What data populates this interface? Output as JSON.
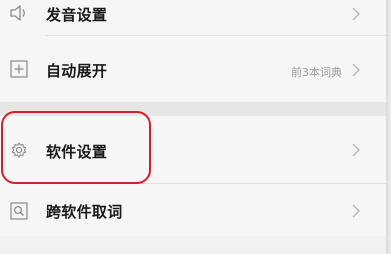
{
  "settings": {
    "items": [
      {
        "label": "发音设置",
        "value": "",
        "icon": "speaker-icon"
      },
      {
        "label": "自动展开",
        "value": "前3本词典",
        "icon": "plus-square-icon"
      },
      {
        "label": "软件设置",
        "value": "",
        "icon": "gear-icon"
      },
      {
        "label": "跨软件取词",
        "value": "",
        "icon": "search-square-icon"
      }
    ]
  },
  "colors": {
    "highlight": "#d11f2c",
    "row_background": "#f6f6f6",
    "text": "#1a1a1a",
    "secondary_text": "#9a9a9a"
  }
}
